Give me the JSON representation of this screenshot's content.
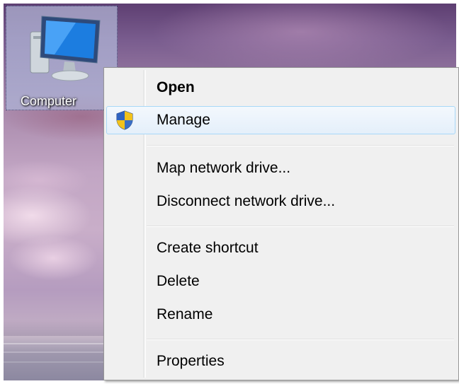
{
  "desktop": {
    "computer_icon": {
      "label": "Computer",
      "icon": "computer-monitor-icon"
    }
  },
  "context_menu": {
    "items": [
      {
        "label": "Open",
        "bold": true
      },
      {
        "label": "Manage",
        "icon": "uac-shield-icon",
        "highlighted": true
      },
      {
        "label": "Map network drive..."
      },
      {
        "label": "Disconnect network drive..."
      },
      {
        "label": "Create shortcut"
      },
      {
        "label": "Delete"
      },
      {
        "label": "Rename"
      },
      {
        "label": "Properties"
      }
    ]
  },
  "colors": {
    "highlight_border": "#a8d8f8",
    "menu_background": "#f0f0f0"
  }
}
